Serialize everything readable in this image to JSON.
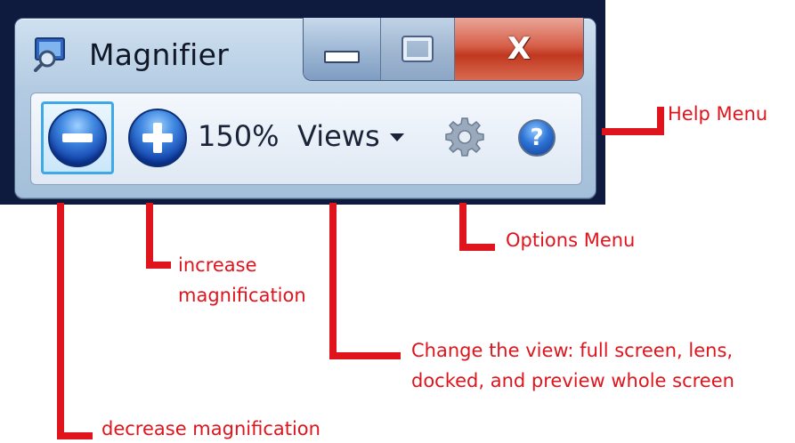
{
  "window": {
    "title": "Magnifier",
    "icon": "magnifier-app-icon",
    "caption_buttons": {
      "minimize_icon": "minimize-icon",
      "maximize_icon": "maximize-icon",
      "close_label": "X"
    }
  },
  "toolbar": {
    "zoom_out_icon": "zoom-out-icon",
    "zoom_in_icon": "zoom-in-icon",
    "zoom_level": "150%",
    "views_label": "Views",
    "views_caret_icon": "chevron-down-icon",
    "options_icon": "gear-icon",
    "help_glyph": "?"
  },
  "annotations": {
    "help": "Help Menu",
    "options": "Options Menu",
    "increase_line1": "increase",
    "increase_line2": "magnification",
    "views_line1": "Change the view: full screen, lens,",
    "views_line2": "docked, and preview whole screen",
    "decrease": "decrease magnification"
  },
  "colors": {
    "annotation_red": "#e0141c",
    "window_frame": "#b3cbe2",
    "close_button": "#c0381f"
  }
}
